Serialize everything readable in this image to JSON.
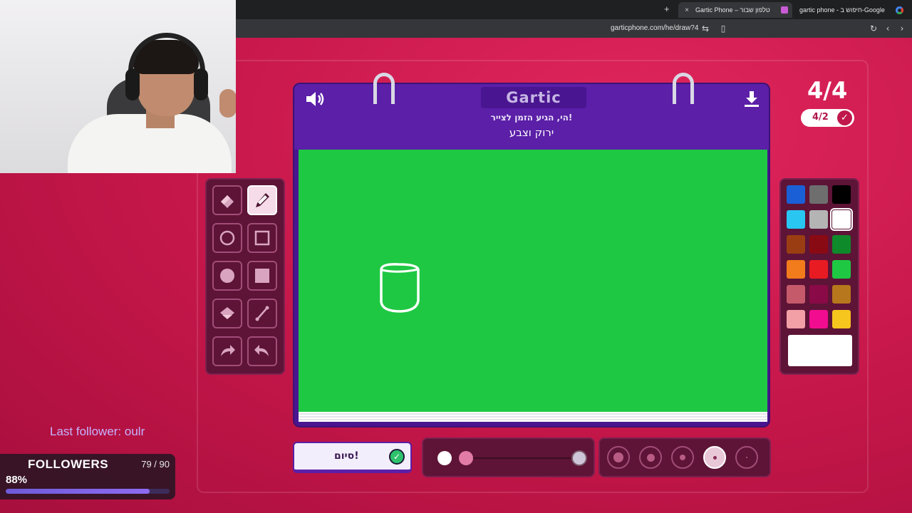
{
  "browser": {
    "new_tab": "+",
    "tabs": [
      {
        "title": "Gartic Phone – טלפון שבור",
        "close": "×"
      },
      {
        "title": "gartic phone - חיפוש ב-Google"
      }
    ],
    "url": "garticphone.com/he/draw?4"
  },
  "game": {
    "logo": "Gartic",
    "prompt_subtitle": "הי, הגיע הזמן לצייר!",
    "prompt_text": "ירוק וצבע",
    "round": "4/4",
    "done_status": "4/2",
    "done_button": "סיום!",
    "tools": [
      "eraser-icon",
      "pencil-icon",
      "circle-outline-icon",
      "square-outline-icon",
      "circle-fill-icon",
      "square-fill-icon",
      "bucket-icon",
      "line-icon",
      "undo-icon",
      "redo-icon"
    ],
    "selected_tool": "pencil-icon",
    "palette": [
      [
        "#1a5fd6",
        "#6e6e6e",
        "#000000"
      ],
      [
        "#29c6f2",
        "#b4b4b4",
        "#ffffff"
      ],
      [
        "#9a3d12",
        "#8a0a14",
        "#0f8a2a"
      ],
      [
        "#f27c1c",
        "#e81b22",
        "#1ec843"
      ],
      [
        "#c55a6b",
        "#8a0a47",
        "#b7771c"
      ],
      [
        "#f2a0a6",
        "#f20c8f",
        "#f6c51e"
      ]
    ],
    "selected_color": "#ffffff",
    "background_color": "#1ec843",
    "opacity": 0.0,
    "selected_brush_size_index": 3
  },
  "overlay": {
    "last_follower": "Last follower: oulr",
    "followers_title": "FOLLOWERS",
    "followers_count": "79 / 90",
    "followers_percent_text": "88%",
    "followers_progress": 0.88
  }
}
